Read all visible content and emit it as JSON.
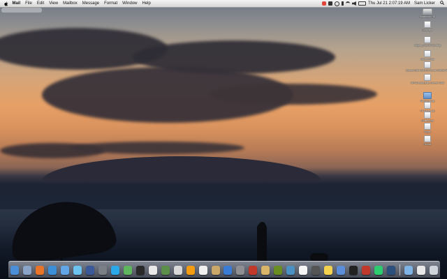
{
  "menubar": {
    "app_name": "Mail",
    "menus": [
      "File",
      "Edit",
      "View",
      "Mailbox",
      "Message",
      "Format",
      "Window",
      "Help"
    ],
    "clock": "Thu Jul 21  2:07:19 AM",
    "user": "Sam Licker"
  },
  "finder_search": {
    "placeholder": ""
  },
  "desktop_icons": [
    {
      "label": "Macintosh HD",
      "kind": "hd"
    },
    {
      "label": "Scanners",
      "kind": "file"
    },
    {
      "label": "Skype_2011-07-21.dmg",
      "kind": "file"
    },
    {
      "label": "Screen Shot",
      "kind": "file"
    },
    {
      "label": "Screen Shot 2011-07-21 at 2.06.55 AM",
      "kind": "file"
    },
    {
      "label": "WPA2 Enterprise Screen Shot",
      "kind": "file"
    },
    {
      "label": "AirPort Utility",
      "kind": "folder"
    },
    {
      "label": "Fit Cases.zip",
      "kind": "file"
    },
    {
      "label": "Untitled.zip",
      "kind": "file"
    },
    {
      "label": "Skype",
      "kind": "file"
    },
    {
      "label": "Firefox",
      "kind": "file"
    }
  ],
  "dock": {
    "items": [
      {
        "name": "finder",
        "color": "#4a8fd8"
      },
      {
        "name": "preview",
        "color": "#8aa4c8"
      },
      {
        "name": "firefox",
        "color": "#e8742a"
      },
      {
        "name": "safari",
        "color": "#3b8ed8"
      },
      {
        "name": "ichat",
        "color": "#63a6e8"
      },
      {
        "name": "twitter",
        "color": "#6cc3f0"
      },
      {
        "name": "facebook",
        "color": "#3b5998"
      },
      {
        "name": "facetime",
        "color": "#7a7f86"
      },
      {
        "name": "skype",
        "color": "#2aa8e8"
      },
      {
        "name": "messenger",
        "color": "#5fb65f"
      },
      {
        "name": "blackberry",
        "color": "#2a2a2a"
      },
      {
        "name": "itunes-radio",
        "color": "#e9e9e9"
      },
      {
        "name": "textwrangler",
        "color": "#5c8f4a"
      },
      {
        "name": "mail",
        "color": "#d8d8d8"
      },
      {
        "name": "vlc",
        "color": "#f39c12"
      },
      {
        "name": "calendar",
        "color": "#f0f0f0"
      },
      {
        "name": "notes",
        "color": "#c9a86a"
      },
      {
        "name": "app-store",
        "color": "#3a7bd5"
      },
      {
        "name": "system-preferences",
        "color": "#8e8e93"
      },
      {
        "name": "photo-booth",
        "color": "#c0392b"
      },
      {
        "name": "iphoto",
        "color": "#d9b56a"
      },
      {
        "name": "utility",
        "color": "#6b8e23"
      },
      {
        "name": "xcode",
        "color": "#4a90c2"
      },
      {
        "name": "textedit",
        "color": "#f5f5f5"
      },
      {
        "name": "aperture",
        "color": "#555555"
      },
      {
        "name": "stickies",
        "color": "#f3d250"
      },
      {
        "name": "itunes",
        "color": "#5b8dd9"
      },
      {
        "name": "iterm",
        "color": "#222222"
      },
      {
        "name": "transmission",
        "color": "#c0392b"
      },
      {
        "name": "activity-monitor",
        "color": "#2ecc71"
      },
      {
        "name": "time-machine",
        "color": "#2d4f7c"
      }
    ],
    "right_items": [
      {
        "name": "applications-stack",
        "color": "#7fb3e6"
      },
      {
        "name": "documents-stack",
        "color": "#e8e8e8"
      },
      {
        "name": "trash",
        "color": "#cfd4da"
      }
    ]
  }
}
